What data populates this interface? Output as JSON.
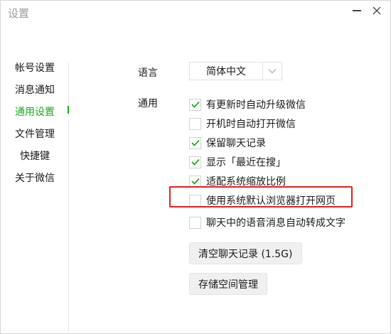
{
  "window": {
    "title": "设置",
    "minimize_icon": "minimize-icon",
    "close_icon": "close-icon"
  },
  "sidebar": {
    "items": [
      {
        "label": "帐号设置",
        "active": false
      },
      {
        "label": "消息通知",
        "active": false
      },
      {
        "label": "通用设置",
        "active": true
      },
      {
        "label": "文件管理",
        "active": false
      },
      {
        "label": "快捷键",
        "active": false
      },
      {
        "label": "关于微信",
        "active": false
      }
    ]
  },
  "general": {
    "language_label": "语言",
    "language_value": "简体中文",
    "general_label": "通用",
    "options": [
      {
        "label": "有更新时自动升级微信",
        "checked": true
      },
      {
        "label": "开机时自动打开微信",
        "checked": false
      },
      {
        "label": "保留聊天记录",
        "checked": true
      },
      {
        "label": "显示「最近在搜」",
        "checked": true
      },
      {
        "label": "适配系统缩放比例",
        "checked": true
      },
      {
        "label": "使用系统默认浏览器打开网页",
        "checked": false
      },
      {
        "label": "聊天中的语音消息自动转成文字",
        "checked": false
      }
    ],
    "clear_history_button": "清空聊天记录 (1.5G)",
    "storage_button": "存储空间管理"
  },
  "colors": {
    "accent": "#1aad19",
    "highlight": "#e02020"
  }
}
